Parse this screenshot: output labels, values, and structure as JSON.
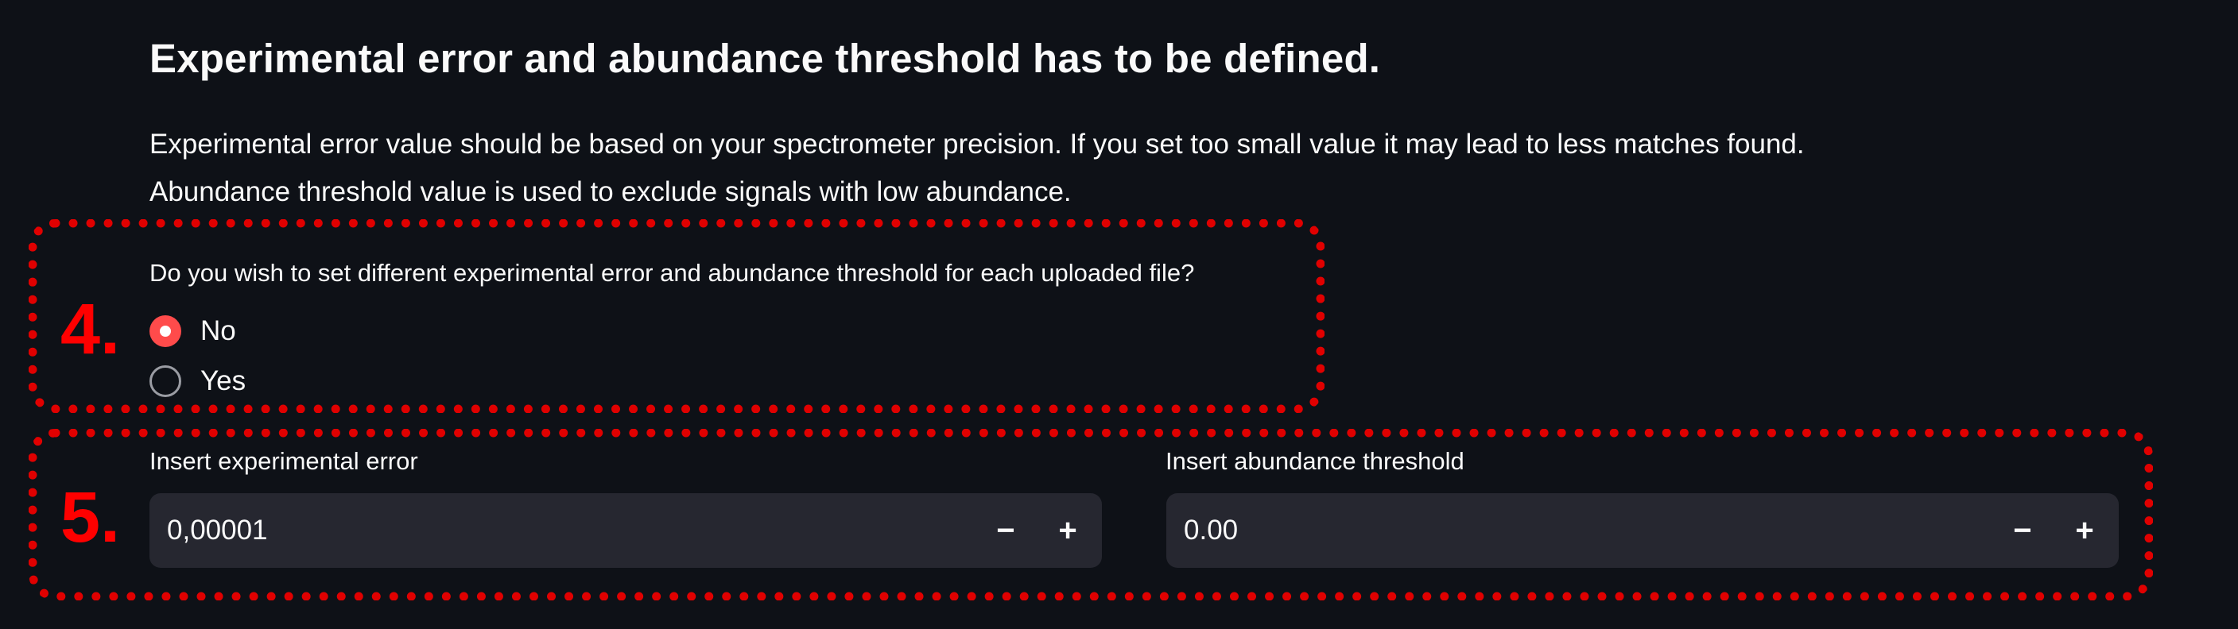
{
  "header": {
    "title": "Experimental error and abundance threshold has to be defined.",
    "description_1": "Experimental error value should be based on your spectrometer precision. If you set too small value it may lead to less matches found.",
    "description_2": "Abundance threshold value is used to exclude signals with low abundance."
  },
  "annotations": {
    "step_4": "4.",
    "step_5": "5.",
    "color": "#e00000"
  },
  "per_file_choice": {
    "question": "Do you wish to set different experimental error and abundance threshold for each uploaded file?",
    "options": [
      {
        "label": "No",
        "selected": true
      },
      {
        "label": "Yes",
        "selected": false
      }
    ]
  },
  "inputs": {
    "experimental_error": {
      "label": "Insert experimental error",
      "value": "0,00001",
      "decrement": "−",
      "increment": "+"
    },
    "abundance_threshold": {
      "label": "Insert abundance threshold",
      "value": "0.00",
      "decrement": "−",
      "increment": "+"
    }
  },
  "colors": {
    "background": "#0e1117",
    "input_background": "#262730",
    "accent": "#ff4b4b",
    "text": "#fafafa"
  }
}
